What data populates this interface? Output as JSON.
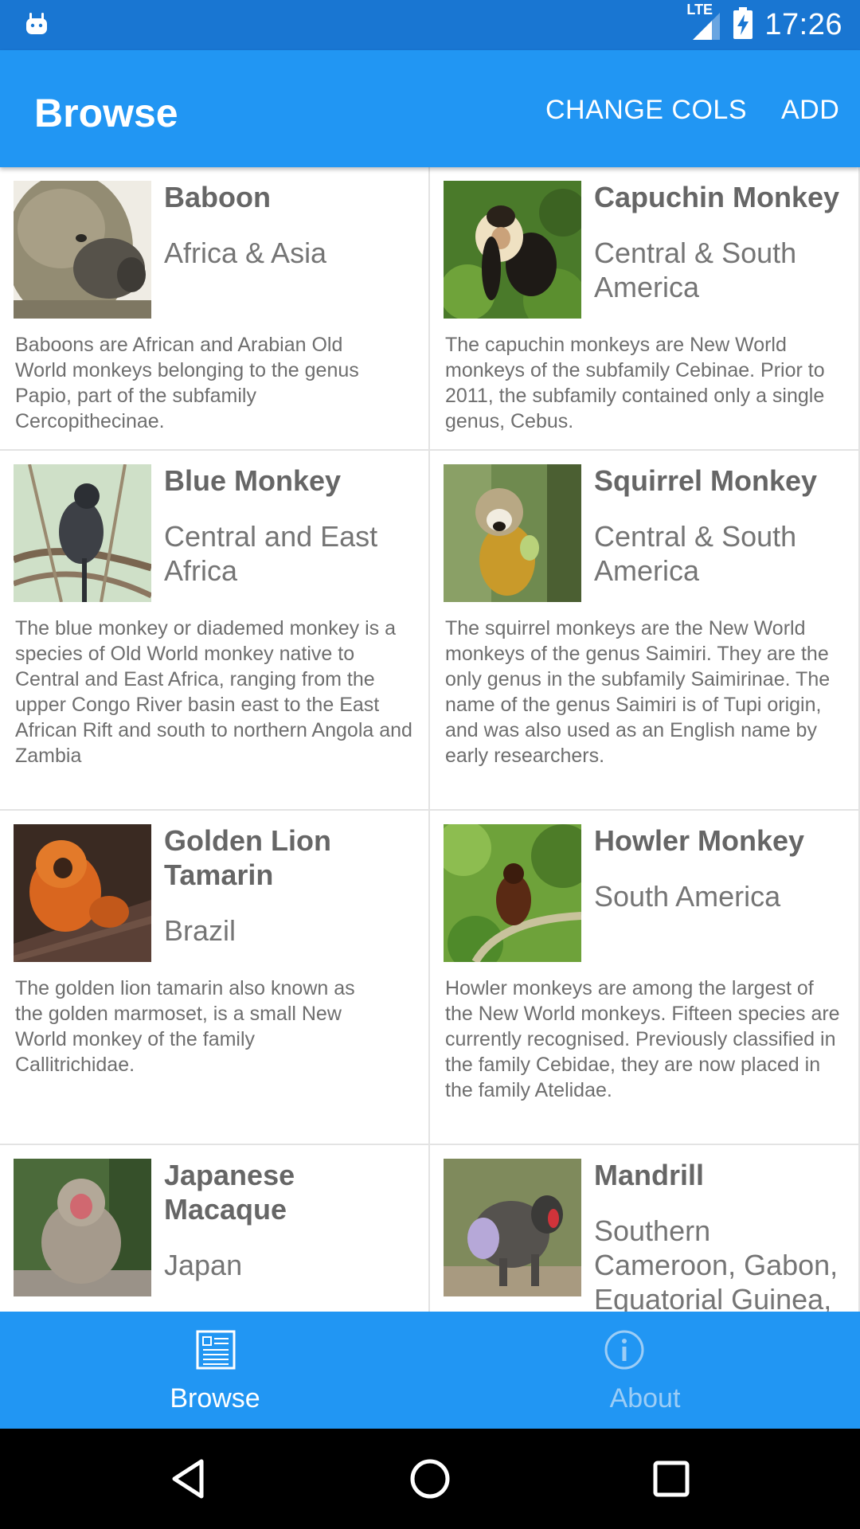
{
  "status_bar": {
    "time": "17:26",
    "network": "LTE",
    "icons": [
      "android-icon",
      "signal-icon",
      "battery-charging-icon"
    ]
  },
  "app_bar": {
    "title": "Browse",
    "actions": [
      "CHANGE COLS",
      "ADD"
    ]
  },
  "cards": [
    {
      "name": "Baboon",
      "region": "Africa & Asia",
      "description": "Baboons are African and Arabian Old World monkeys belonging to the genus Papio, part of the subfamily Cercopithecinae."
    },
    {
      "name": "Capuchin Monkey",
      "region": "Central & South America",
      "description": "The capuchin monkeys are New World monkeys of the subfamily Cebinae. Prior to 2011, the subfamily contained only a single genus, Cebus."
    },
    {
      "name": "Blue Monkey",
      "region": "Central and East Africa",
      "description": "The blue monkey or diademed monkey is a species of Old World monkey native to Central and East Africa, ranging from the upper Congo River basin east to the East African Rift and south to northern Angola and Zambia"
    },
    {
      "name": "Squirrel Monkey",
      "region": "Central & South America",
      "description": "The squirrel monkeys are the New World monkeys of the genus Saimiri. They are the only genus in the subfamily Saimirinae. The name of the genus Saimiri is of Tupi origin, and was also used as an English name by early researchers."
    },
    {
      "name": "Golden Lion Tamarin",
      "region": "Brazil",
      "description": "The golden lion tamarin also known as the golden marmoset, is a small New World monkey of the family Callitrichidae."
    },
    {
      "name": "Howler Monkey",
      "region": "South America",
      "description": "Howler monkeys are among the largest of the New World monkeys. Fifteen species are currently recognised. Previously classified in the family Cebidae, they are now placed in the family Atelidae."
    },
    {
      "name": "Japanese Macaque",
      "region": "Japan",
      "description": ""
    },
    {
      "name": "Mandrill",
      "region": "Southern Cameroon, Gabon, Equatorial Guinea,",
      "description": ""
    }
  ],
  "bottom_nav": {
    "items": [
      {
        "label": "Browse",
        "icon": "browse-list-icon",
        "selected": true
      },
      {
        "label": "About",
        "icon": "info-icon",
        "selected": false
      }
    ]
  },
  "system_nav": {
    "buttons": [
      "back-icon",
      "home-icon",
      "recents-icon"
    ]
  },
  "colors": {
    "status_bar": "#1976d2",
    "primary": "#2196f3",
    "card_title": "#666666",
    "card_text": "#6e6e6e"
  }
}
